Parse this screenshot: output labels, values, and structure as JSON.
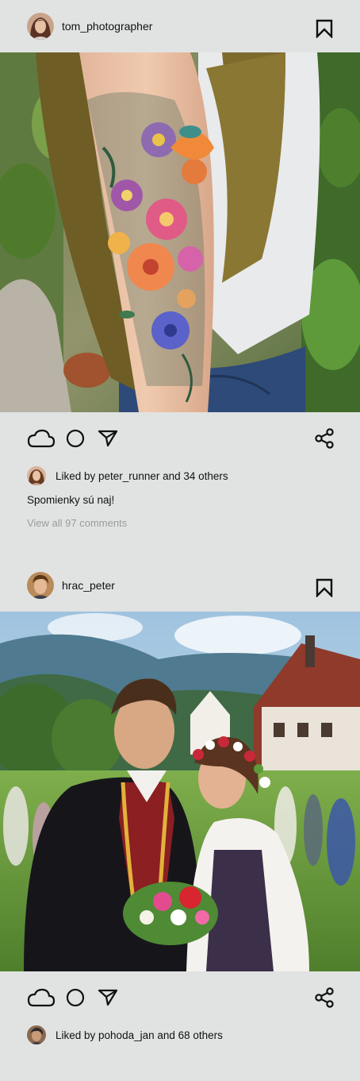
{
  "posts": [
    {
      "username": "tom_photographer",
      "liked_by_user": "peter_runner",
      "liked_text": "Liked by peter_runner and 34 others",
      "caption": "Spomienky sú naj!",
      "comments_link": "View all 97 comments",
      "photo_subject": "tattooed forearm with colorful flower sleeve tattoo"
    },
    {
      "username": "hrac_peter",
      "liked_by_user": "pohoda_jan",
      "liked_text": "Liked by pohoda_jan and 68 others",
      "photo_subject": "couple in Slovak folk costumes at outdoor festival"
    }
  ],
  "icons": {
    "like": "cloud-icon",
    "comment": "circle-icon",
    "send": "send-icon",
    "share": "share-icon",
    "save": "bookmark-icon"
  },
  "colors": {
    "background": "#e1e3e2",
    "text": "#111111",
    "muted": "#9a9c9b"
  }
}
